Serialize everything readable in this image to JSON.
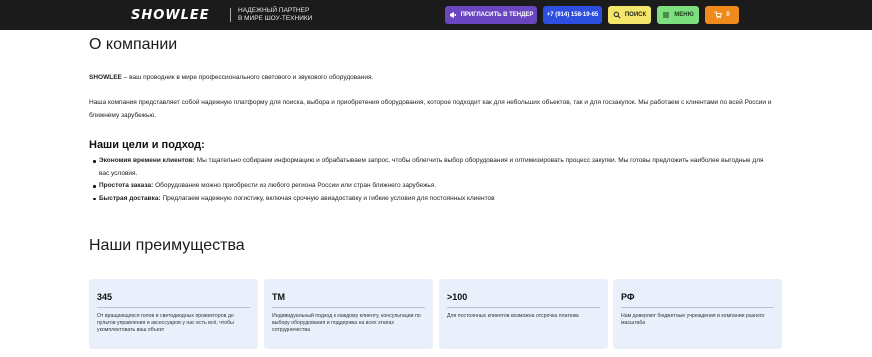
{
  "header": {
    "logo": "SHOWLEE",
    "tagline_line1": "НАДЕЖНЫЙ ПАРТНЕР",
    "tagline_line2": "В МИРЕ ШОУ-ТЕХНИКИ",
    "tender_label": "ПРИГЛАСИТЬ В ТЕНДЕР",
    "phone_label": "+7 (914) 158-19-65",
    "search_label": "ПОИСК",
    "menu_label": "МЕНЮ",
    "cart_count": "0"
  },
  "about": {
    "title": "О компании",
    "intro_brand": "SHOWLEE",
    "intro_text": " – ваш проводник в мире профессионального светового и звукового оборудования.",
    "paragraph": "Наша компания представляет собой надежную платформу для поиска, выбора и приобретения оборудования, которое подходит как для небольших объектов, так и для госзакупок. Мы работаем с клиентами по всей России и ближнему зарубежью."
  },
  "goals": {
    "title": "Наши цели и подход:",
    "items": [
      {
        "label": "Экономия времени клиентов:",
        "text": " Мы тщательно собираем информацию и обрабатываем запрос, чтобы облегчить выбор оборудования и оптимизировать процесс закупки. Мы готовы предложить наиболее выгодные для вас условия."
      },
      {
        "label": "Простота заказа:",
        "text": " Оборудование можно приобрести из любого региона России или стран ближнего зарубежья."
      },
      {
        "label": "Быстрая доставка:",
        "text": " Предлагаем надежную логистику, включая срочную авиадоставку и гибкие условия для постоянных клиентов"
      }
    ]
  },
  "advantages": {
    "title": "Наши преимущества",
    "cards": [
      {
        "value": "345",
        "desc": "От вращающихся голов и светодиодных прожекторов до пультов управления  и аксессуаров   у нас есть всё, чтобы укомплектовать ваш объект"
      },
      {
        "value": "ТМ",
        "desc": "Индивидуальный подход к каждому клиенту, консультации по выбору оборудования  и поддержка на всех этапах сотрудничества"
      },
      {
        "value": ">100",
        "desc": "Для постоянных клиентов возможна отсрочка платежа"
      },
      {
        "value": "РФ",
        "desc": "Нам доверяют бюджетные учреждения  и компании разного масштаба"
      }
    ]
  },
  "colors": {
    "header_bg": "#1b1b1b",
    "tender": "#6b46c1",
    "phone": "#2d4fe0",
    "search": "#f4e66a",
    "menu": "#7ddf7d",
    "cart": "#f08a1c",
    "card_bg": "#e9f0fb"
  },
  "icons": [
    "tender-icon",
    "search-icon",
    "menu-icon",
    "cart-icon"
  ]
}
